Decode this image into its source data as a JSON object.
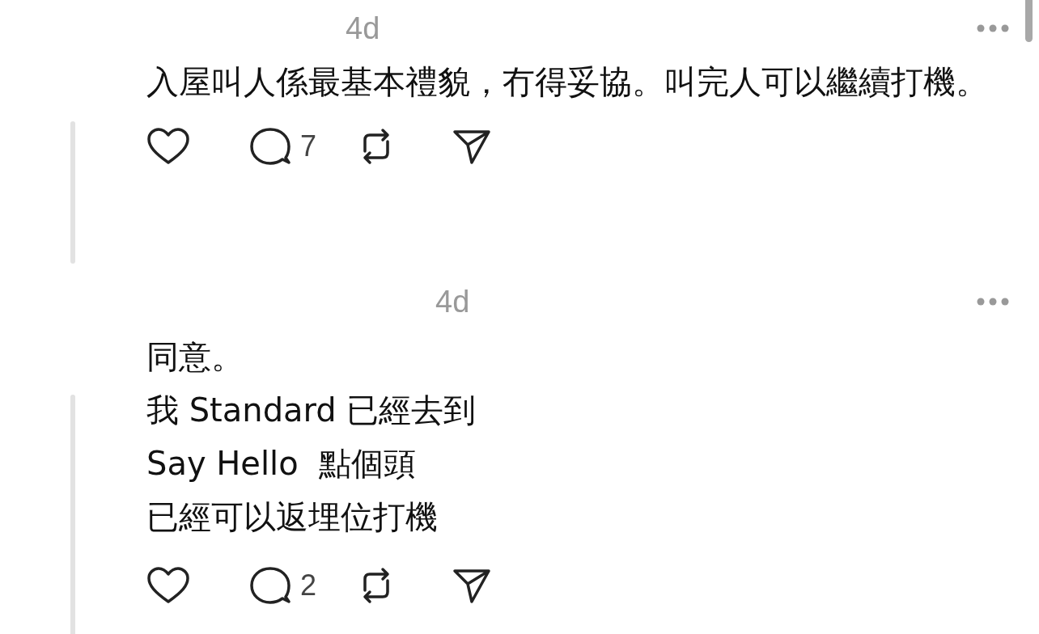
{
  "posts": [
    {
      "time": "4d",
      "lines": [
        "入屋叫人係最基本禮貌，冇得妥協。叫完人可以繼續打機。"
      ],
      "replies": "7"
    },
    {
      "time": "4d",
      "lines": [
        "同意。",
        "我 Standard 已經去到",
        "Say Hello  點個頭",
        "已經可以返埋位打機"
      ],
      "replies": "2"
    }
  ]
}
